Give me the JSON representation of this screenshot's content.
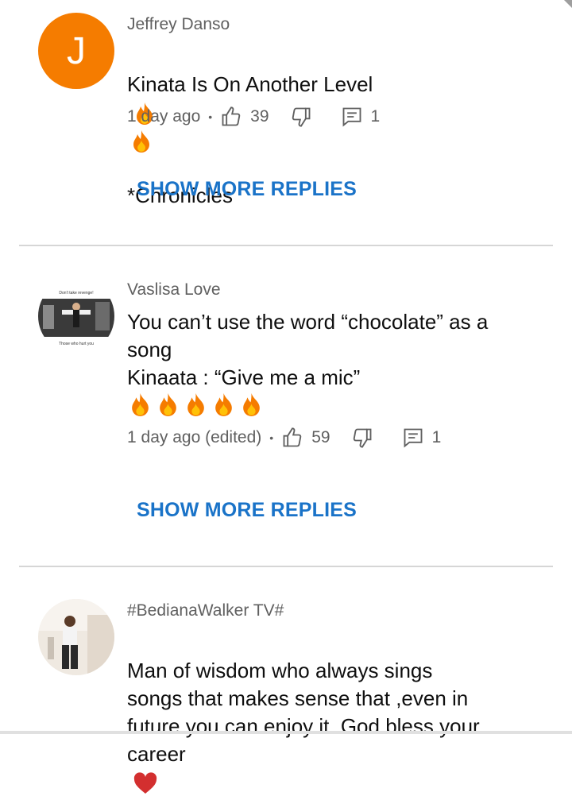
{
  "comments": [
    {
      "author": "Jeffrey Danso",
      "avatar_letter": "J",
      "text_line1": "Kinata Is On Another Level",
      "text_line2": "*Chronicles",
      "time": "1 day ago",
      "likes": "39",
      "replies": "1",
      "show_more": "SHOW MORE REPLIES"
    },
    {
      "author": "Vaslisa Love",
      "avatar_caption_top": "Don't take revenge!",
      "avatar_caption_bottom": "Those who hurt you",
      "text": "You can’t use the word “chocolate” as a\nsong\nKinaata : “Give me a mic”",
      "time": "1 day ago (edited)",
      "likes": "59",
      "replies": "1",
      "show_more": "SHOW MORE REPLIES"
    },
    {
      "author": "#BedianaWalker TV#",
      "text": "Man of wisdom who always sings\nsongs that makes sense that ,even in\nfuture you can enjoy it. God bless your\ncareer"
    }
  ],
  "colors": {
    "accent": "#1a73c8",
    "avatar_orange": "#f57c00",
    "meta_gray": "#606060"
  },
  "icons": [
    "thumb-up-icon",
    "thumb-down-icon",
    "reply-icon",
    "fire-emoji",
    "heart-emoji"
  ]
}
